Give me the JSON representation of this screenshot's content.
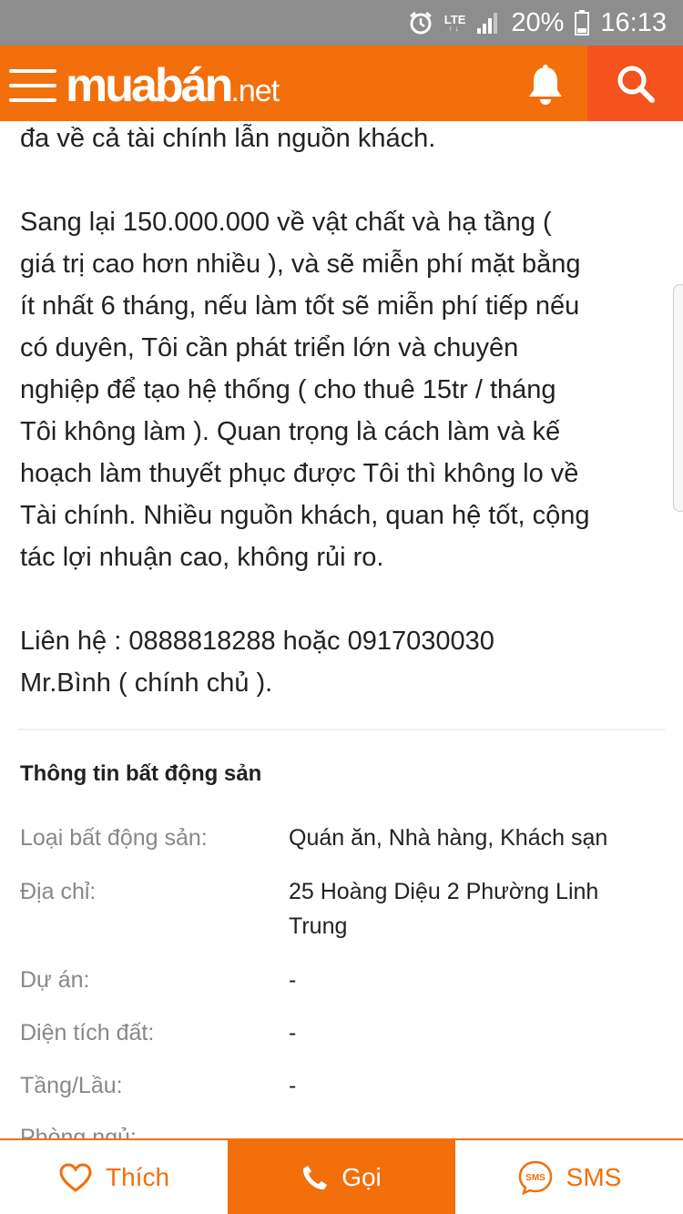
{
  "status_bar": {
    "network": "LTE",
    "battery": "20%",
    "time": "16:13"
  },
  "header": {
    "logo_main": "muabán",
    "logo_tld": ".net",
    "icons": [
      "menu-icon",
      "bell-icon",
      "search-icon"
    ],
    "brand_color": "#f26f0c",
    "search_bg_color": "#f4531e"
  },
  "description": {
    "lines": [
      "đa về cả tài chính lẫn nguồn khách.",
      "",
      "Sang lại 150.000.000 về vật chất và hạ tầng (",
      "giá trị cao hơn nhiều ), và sẽ miễn phí mặt bằng",
      "ít nhất 6 tháng, nếu làm tốt sẽ miễn phí tiếp nếu",
      "có duyên, Tôi cần phát triển lớn và chuyên",
      "nghiệp để tạo hệ thống ( cho thuê 15tr / tháng",
      "Tôi không làm ). Quan trọng là cách làm và kế",
      "hoạch làm thuyết phục được Tôi thì không lo về",
      "Tài chính. Nhiều nguồn khách, quan hệ tốt, cộng",
      "tác lợi nhuận cao, không rủi ro.",
      "",
      "Liên hệ : 0888818288 hoặc 0917030030",
      "Mr.Bình ( chính chủ )."
    ]
  },
  "property_info": {
    "title": "Thông tin bất động sản",
    "rows": [
      {
        "label": "Loại bất động sản:",
        "value": "Quán ăn, Nhà hàng, Khách sạn"
      },
      {
        "label": "Địa chỉ:",
        "value": "25 Hoàng Diệu 2 Phường Linh Trung"
      },
      {
        "label": "Dự án:",
        "value": "-"
      },
      {
        "label": "Diện tích đất:",
        "value": "-"
      },
      {
        "label": "Tầng/Lầu:",
        "value": "-"
      },
      {
        "label": "Phòng ngủ:",
        "value": ""
      }
    ]
  },
  "bottom_bar": {
    "like_label": "Thích",
    "call_label": "Gọi",
    "sms_label": "SMS",
    "sms_icon_text": "SMS"
  }
}
